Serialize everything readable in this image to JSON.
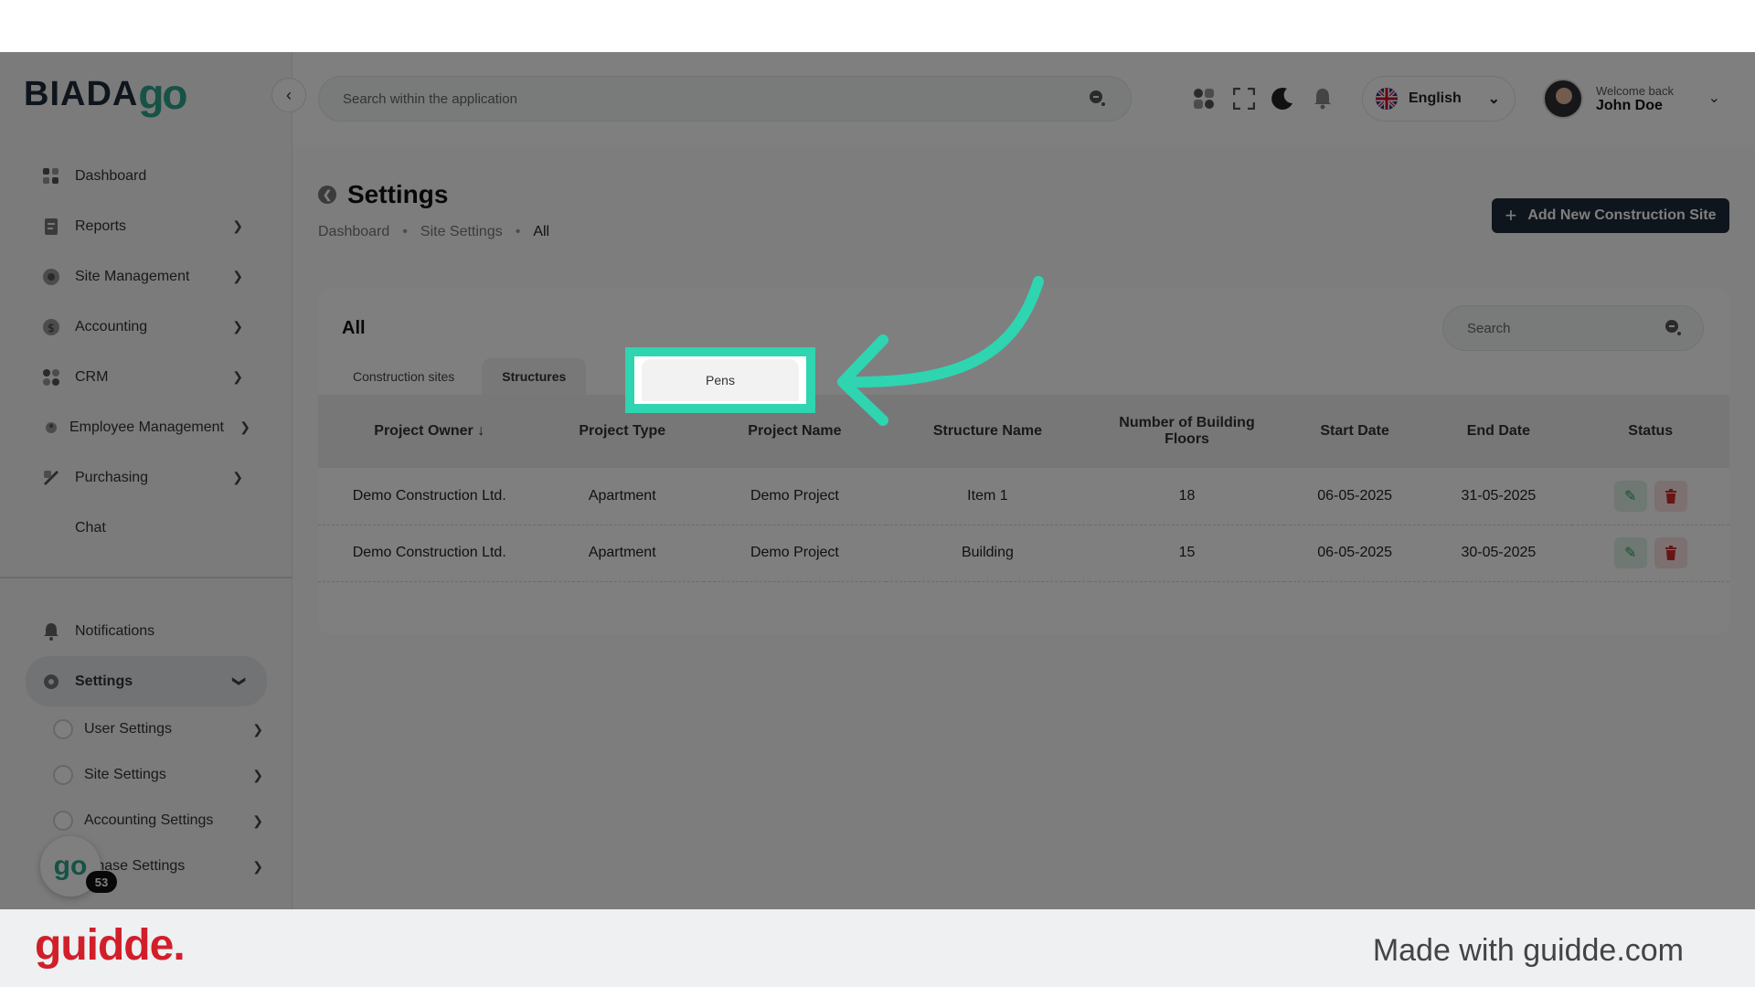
{
  "logo": {
    "text": "BIADA",
    "go": "go"
  },
  "sidebar": {
    "items": [
      {
        "label": "Dashboard"
      },
      {
        "label": "Reports"
      },
      {
        "label": "Site Management"
      },
      {
        "label": "Accounting"
      },
      {
        "label": "CRM"
      },
      {
        "label": "Employee Management"
      },
      {
        "label": "Purchasing"
      },
      {
        "label": "Chat"
      }
    ],
    "bottom": [
      {
        "label": "Notifications"
      },
      {
        "label": "Settings"
      }
    ],
    "settings_sub": [
      {
        "label": "User Settings"
      },
      {
        "label": "Site Settings"
      },
      {
        "label": "Accounting Settings"
      },
      {
        "label": "rchase Settings"
      }
    ],
    "float_logo": "go",
    "float_badge": "53"
  },
  "header": {
    "search_placeholder": "Search within the application",
    "language": "English",
    "welcome": "Welcome back",
    "user_name": "John Doe"
  },
  "page": {
    "title": "Settings",
    "breadcrumb": [
      "Dashboard",
      "Site Settings",
      "All"
    ],
    "add_button": "Add New Construction Site"
  },
  "card": {
    "title": "All",
    "search_placeholder": "Search",
    "tabs": [
      "Construction sites",
      "Structures",
      "Pens"
    ],
    "columns": [
      "Project Owner",
      "Project Type",
      "Project Name",
      "Structure Name",
      "Number of Building Floors",
      "Start Date",
      "End Date",
      "Status"
    ],
    "rows": [
      [
        "Demo Construction Ltd.",
        "Apartment",
        "Demo Project",
        "Item 1",
        "18",
        "06-05-2025",
        "31-05-2025"
      ],
      [
        "Demo Construction Ltd.",
        "Apartment",
        "Demo Project",
        "Building",
        "15",
        "06-05-2025",
        "30-05-2025"
      ]
    ]
  },
  "footer": {
    "brand": "guidde.",
    "made_with": "Made with guidde.com"
  },
  "colors": {
    "accent": "#2fd4b0",
    "brand_red": "#d11f2a",
    "dark": "#1c2a38",
    "go_green": "#2fa58d"
  }
}
